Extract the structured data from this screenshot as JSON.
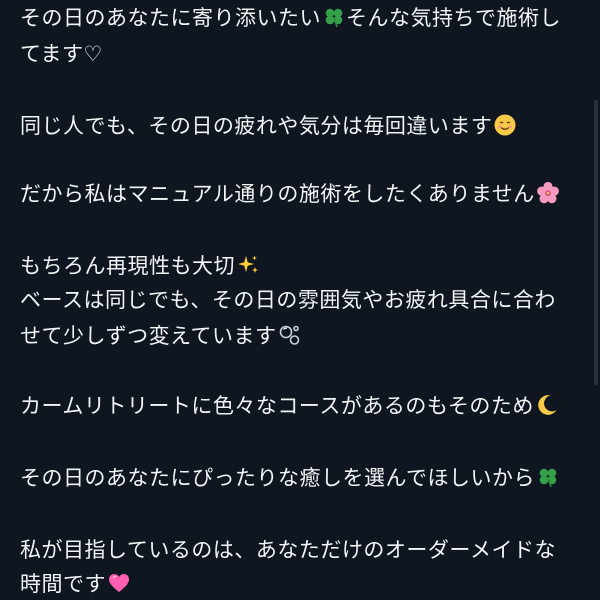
{
  "post": {
    "lines": [
      "その日のあなたに寄り添いたい",
      "そんな気持ちで施術し",
      "てます♡",
      "同じ人でも、その日の疲れや気分は毎回違います",
      "だから私はマニュアル通りの施術をしたくありません",
      "もちろん再現性も大切",
      "ベースは同じでも、その日の雰囲気やお疲れ具合に合わ",
      "せて少しずつ変えています",
      "カームリトリートに色々なコースがあるのもそのため",
      "その日のあなたにぴったりな癒しを選んでほしいから",
      "私が目指しているのは、あなただけのオーダーメイドな",
      "時間です"
    ]
  },
  "icons": {
    "clover": "four-leaf-clover-icon",
    "smile": "smiling-face-icon",
    "blossom": "cherry-blossom-icon",
    "sparkles": "sparkles-icon",
    "bubbles": "bubbles-icon",
    "moon": "crescent-moon-icon",
    "heart": "pink-heart-icon"
  },
  "colors": {
    "background": "#0f1620",
    "text": "#f2f4f6",
    "clover": "#35a04a",
    "blossom": "#f49bbd",
    "sparkles": "#ffcf3a",
    "moon": "#f7c948",
    "heart": "#ff5fb0"
  }
}
